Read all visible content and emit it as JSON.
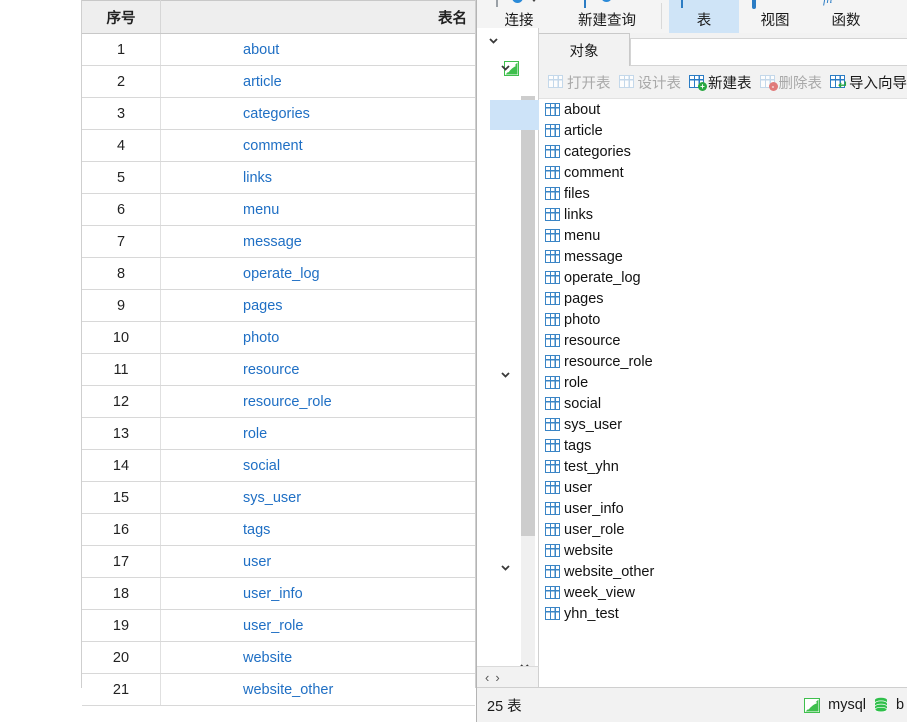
{
  "left_table": {
    "headers": {
      "index": "序号",
      "name": "表名"
    },
    "rows": [
      {
        "idx": "1",
        "name": "about"
      },
      {
        "idx": "2",
        "name": "article"
      },
      {
        "idx": "3",
        "name": "categories"
      },
      {
        "idx": "4",
        "name": "comment"
      },
      {
        "idx": "5",
        "name": "links"
      },
      {
        "idx": "6",
        "name": "menu"
      },
      {
        "idx": "7",
        "name": "message"
      },
      {
        "idx": "8",
        "name": "operate_log"
      },
      {
        "idx": "9",
        "name": "pages"
      },
      {
        "idx": "10",
        "name": "photo"
      },
      {
        "idx": "11",
        "name": "resource"
      },
      {
        "idx": "12",
        "name": "resource_role"
      },
      {
        "idx": "13",
        "name": "role"
      },
      {
        "idx": "14",
        "name": "social"
      },
      {
        "idx": "15",
        "name": "sys_user"
      },
      {
        "idx": "16",
        "name": "tags"
      },
      {
        "idx": "17",
        "name": "user"
      },
      {
        "idx": "18",
        "name": "user_info"
      },
      {
        "idx": "19",
        "name": "user_role"
      },
      {
        "idx": "20",
        "name": "website"
      },
      {
        "idx": "21",
        "name": "website_other"
      }
    ]
  },
  "navicat": {
    "ribbon": [
      {
        "label": "连接",
        "icon": "connection-icon",
        "selected": false
      },
      {
        "label": "新建查询",
        "icon": "new-query-icon",
        "selected": false
      },
      {
        "label": "表",
        "icon": "table-icon",
        "selected": true
      },
      {
        "label": "视图",
        "icon": "view-icon",
        "selected": false
      },
      {
        "label": "函数",
        "icon": "function-icon",
        "selected": false
      }
    ],
    "object_tab": {
      "label": "对象",
      "collapse_icon": "chevron-up-icon"
    },
    "object_toolbar": [
      {
        "label": "打开表",
        "icon": "open-table-icon",
        "enabled": false,
        "badge": ""
      },
      {
        "label": "设计表",
        "icon": "design-table-icon",
        "enabled": false,
        "badge": ""
      },
      {
        "label": "新建表",
        "icon": "new-table-icon",
        "enabled": true,
        "badge": "+"
      },
      {
        "label": "删除表",
        "icon": "delete-table-icon",
        "enabled": false,
        "badge": "-"
      },
      {
        "label": "导入向导",
        "icon": "import-wizard-icon",
        "enabled": true,
        "badge": ""
      }
    ],
    "object_list": [
      {
        "name": "about"
      },
      {
        "name": "article"
      },
      {
        "name": "categories"
      },
      {
        "name": "comment"
      },
      {
        "name": "files"
      },
      {
        "name": "links"
      },
      {
        "name": "menu"
      },
      {
        "name": "message"
      },
      {
        "name": "operate_log"
      },
      {
        "name": "pages"
      },
      {
        "name": "photo"
      },
      {
        "name": "resource"
      },
      {
        "name": "resource_role"
      },
      {
        "name": "role"
      },
      {
        "name": "social"
      },
      {
        "name": "sys_user"
      },
      {
        "name": "tags"
      },
      {
        "name": "test_yhn"
      },
      {
        "name": "user"
      },
      {
        "name": "user_info"
      },
      {
        "name": "user_role"
      },
      {
        "name": "website"
      },
      {
        "name": "website_other"
      },
      {
        "name": "week_view"
      },
      {
        "name": "yhn_test"
      }
    ],
    "nav_arrows": {
      "prev": "‹",
      "next": "›"
    },
    "statusbar": {
      "count_label": "25 表",
      "connection_name": "mysql",
      "database_name": "b"
    }
  },
  "colors": {
    "link": "#1f6fc4",
    "accent": "#2b7cc4",
    "selected_tab_bg": "#cfe4f7",
    "tree_highlight": "#cde3f8",
    "header_bg": "#eeeeee",
    "panel_bg": "#f2f2f2",
    "mysql_green": "#2fbf4a"
  }
}
